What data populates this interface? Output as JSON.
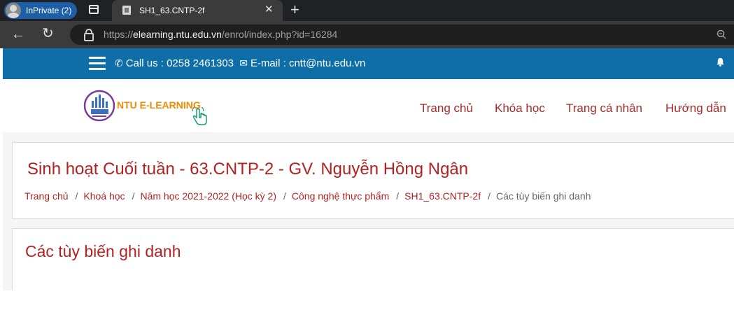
{
  "browser": {
    "private_label": "InPrivate (2)",
    "tab_title": "SH1_63.CNTP-2f",
    "tab_close": "✕",
    "new_tab": "+",
    "back": "←",
    "refresh": "↻",
    "url_prefix": "https://",
    "url_host": "elearning.ntu.edu.vn",
    "url_path": "/enrol/index.php?id=16284"
  },
  "topbar": {
    "phone_icon": "✆",
    "phone_text": "Call us : 0258 2461303",
    "mail_icon": "✉",
    "email_text": "E-mail : cntt@ntu.edu.vn",
    "bg_color": "#0d6ea8"
  },
  "header": {
    "logo_text": "NTU E-LEARNING",
    "nav": [
      "Trang chủ",
      "Khóa học",
      "Trang cá nhân",
      "Hướng dẫn"
    ]
  },
  "course": {
    "title": "Sinh hoạt Cuối tuần - 63.CNTP-2 - GV. Nguyễn Hồng Ngân",
    "breadcrumb": [
      "Trang chủ",
      "Khoá học",
      "Năm học 2021-2022 (Học kỳ 2)",
      "Công nghệ thực phẩm",
      "SH1_63.CNTP-2f",
      "Các tùy biến ghi danh"
    ],
    "breadcrumb_sep": "/"
  },
  "section": {
    "title": "Các tùy biến ghi danh"
  },
  "colors": {
    "accent": "#b22222",
    "logo": "#f08a00"
  }
}
